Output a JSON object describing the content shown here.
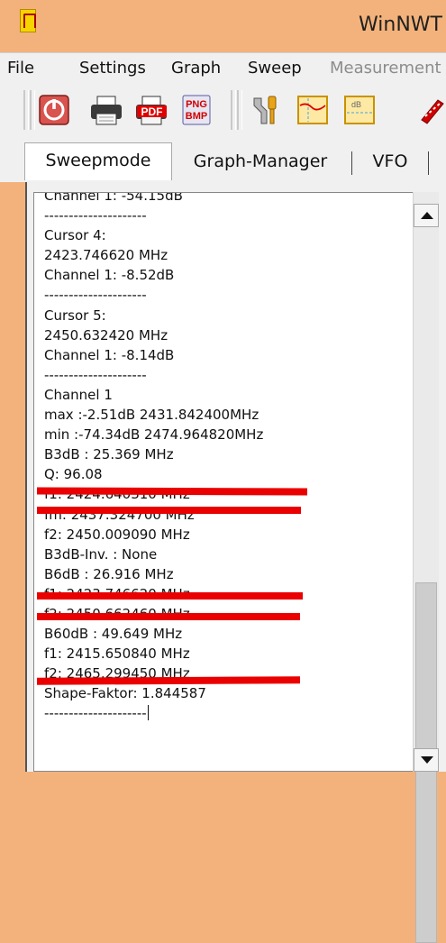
{
  "window": {
    "title": "WinNWT"
  },
  "menu": {
    "items": [
      "File",
      "Settings",
      "Graph",
      "Sweep",
      "Measurement"
    ],
    "disabled_index": 4
  },
  "toolbar": {
    "buttons": [
      {
        "name": "power-icon"
      },
      {
        "name": "printer-icon"
      },
      {
        "name": "pdf-export-icon",
        "label": "PDF"
      },
      {
        "name": "png-bmp-export-icon",
        "label_top": "PNG",
        "label_bottom": "BMP"
      },
      {
        "name": "tools-wrench-icon"
      },
      {
        "name": "graph-marker-icon"
      },
      {
        "name": "db-calibration-icon",
        "label": "dB"
      },
      {
        "name": "probe-icon"
      }
    ]
  },
  "tabs": [
    {
      "label": "Sweepmode",
      "active": true
    },
    {
      "label": "Graph-Manager",
      "active": false
    },
    {
      "label": "VFO",
      "active": false
    }
  ],
  "output": {
    "lines": [
      "Channel 1: -54.15dB",
      "---------------------",
      "Cursor 4:",
      "2423.746620 MHz",
      "Channel 1: -8.52dB",
      "---------------------",
      "Cursor 5:",
      "2450.632420 MHz",
      "Channel 1: -8.14dB",
      "---------------------",
      "Channel 1",
      "max :-2.51dB 2431.842400MHz",
      "min :-74.34dB 2474.964820MHz",
      "B3dB : 25.369 MHz",
      "Q: 96.08",
      "f1: 2424.640310 MHz",
      "fm: 2437.324700 MHz",
      "f2: 2450.009090 MHz",
      "B3dB-Inv. : None",
      "B6dB : 26.916 MHz",
      "f1: 2423.746620 MHz",
      "f2: 2450.662460 MHz",
      "B60dB : 49.649 MHz",
      "f1: 2415.650840 MHz",
      "f2: 2465.299450 MHz",
      "Shape-Faktor: 1.844587",
      "---------------------"
    ]
  },
  "colors": {
    "titlebar": "#f3b27b",
    "annotation_red": "#ea0000"
  }
}
